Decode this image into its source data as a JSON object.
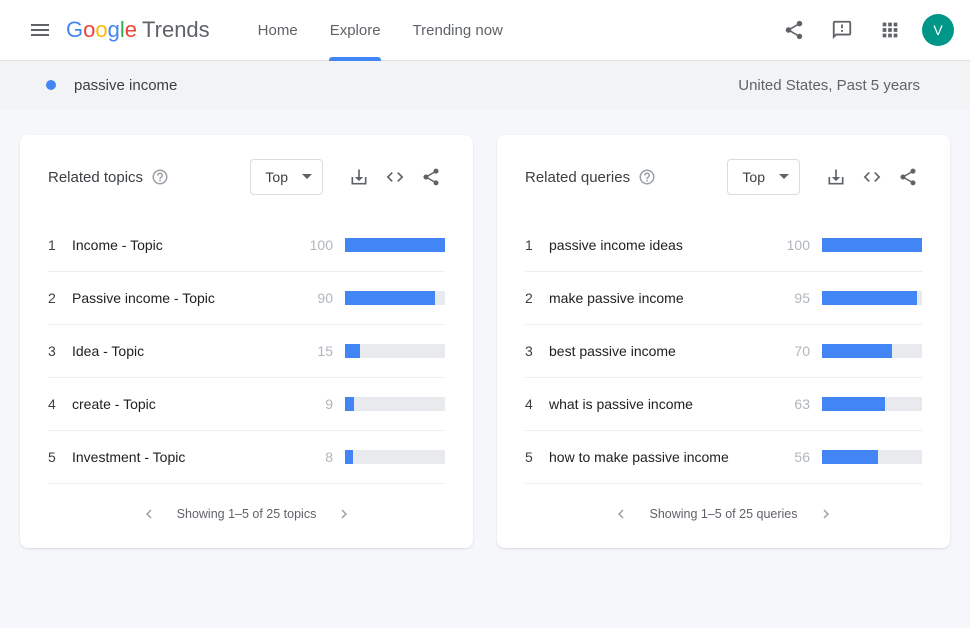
{
  "header": {
    "logo_brand": "Google",
    "logo_product": "Trends",
    "nav": {
      "home": "Home",
      "explore": "Explore",
      "trending": "Trending now"
    },
    "avatar_initial": "V"
  },
  "filter": {
    "term": "passive income",
    "scope": "United States, Past 5 years"
  },
  "dropdown_label": "Top",
  "topics": {
    "title": "Related topics",
    "items": [
      {
        "rank": "1",
        "label": "Income - Topic",
        "value": 100
      },
      {
        "rank": "2",
        "label": "Passive income - Topic",
        "value": 90
      },
      {
        "rank": "3",
        "label": "Idea - Topic",
        "value": 15
      },
      {
        "rank": "4",
        "label": "create - Topic",
        "value": 9
      },
      {
        "rank": "5",
        "label": "Investment - Topic",
        "value": 8
      }
    ],
    "pager": "Showing 1–5 of 25 topics"
  },
  "queries": {
    "title": "Related queries",
    "items": [
      {
        "rank": "1",
        "label": "passive income ideas",
        "value": 100
      },
      {
        "rank": "2",
        "label": "make passive income",
        "value": 95
      },
      {
        "rank": "3",
        "label": "best passive income",
        "value": 70
      },
      {
        "rank": "4",
        "label": "what is passive income",
        "value": 63
      },
      {
        "rank": "5",
        "label": "how to make passive income",
        "value": 56
      }
    ],
    "pager": "Showing 1–5 of 25 queries"
  },
  "chart_data": [
    {
      "type": "bar",
      "title": "Related topics",
      "categories": [
        "Income - Topic",
        "Passive income - Topic",
        "Idea - Topic",
        "create - Topic",
        "Investment - Topic"
      ],
      "values": [
        100,
        90,
        15,
        9,
        8
      ],
      "ylim": [
        0,
        100
      ]
    },
    {
      "type": "bar",
      "title": "Related queries",
      "categories": [
        "passive income ideas",
        "make passive income",
        "best passive income",
        "what is passive income",
        "how to make passive income"
      ],
      "values": [
        100,
        95,
        70,
        63,
        56
      ],
      "ylim": [
        0,
        100
      ]
    }
  ]
}
